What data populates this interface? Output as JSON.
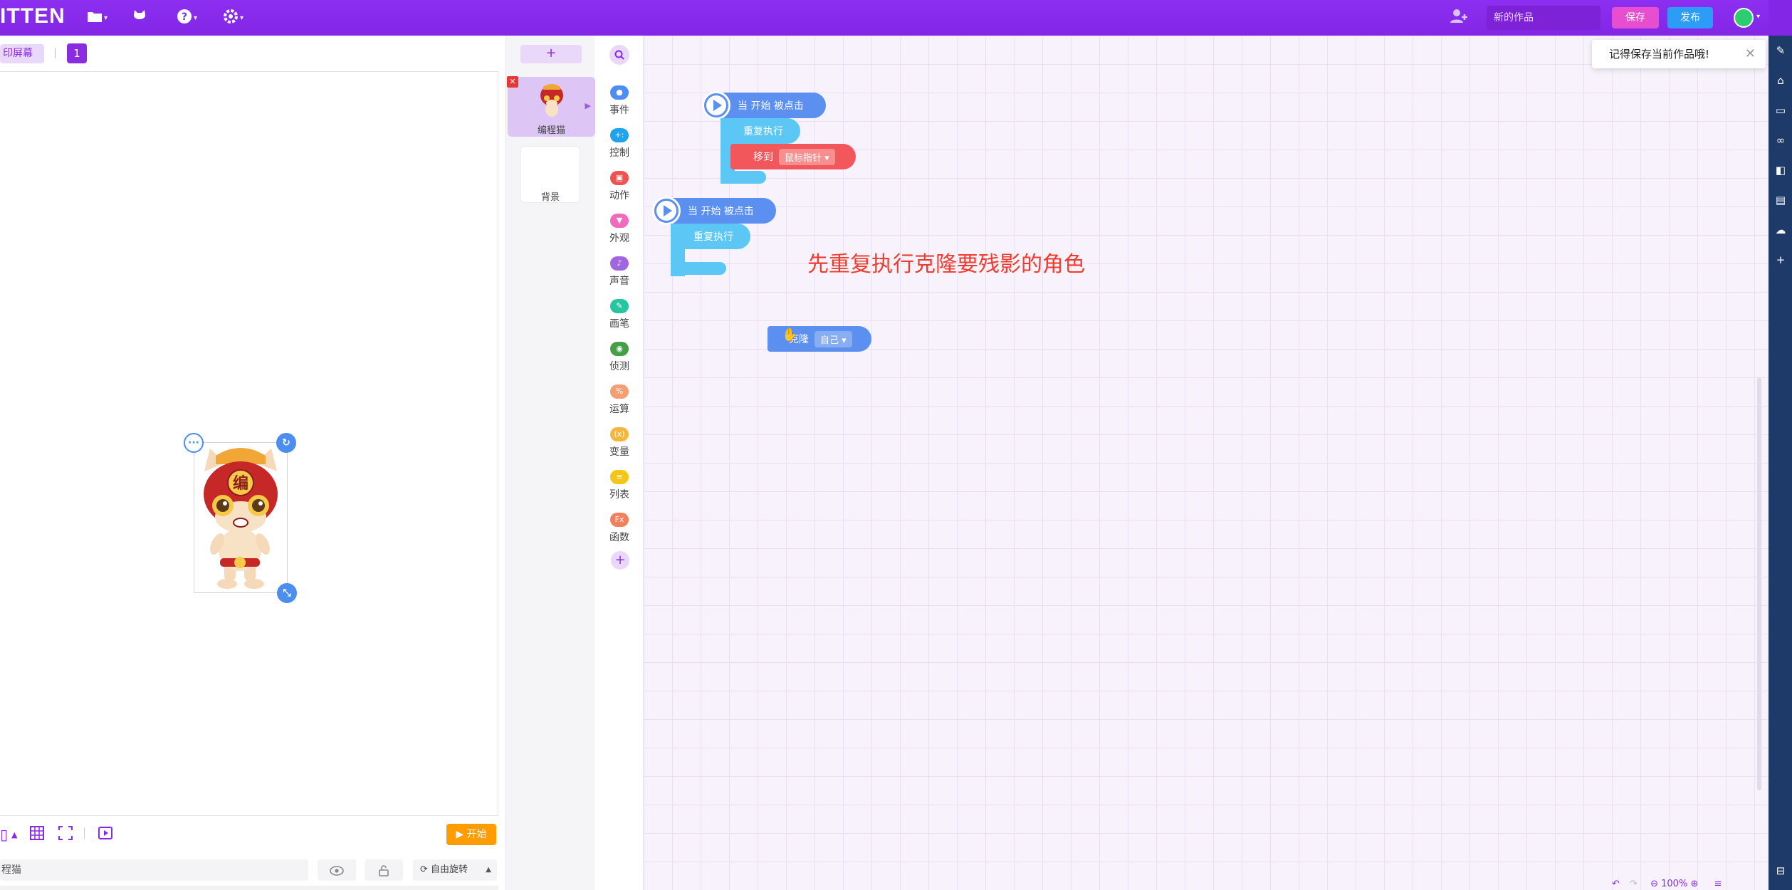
{
  "topbar": {
    "logo": "ITTEN",
    "work_name_placeholder": "新的作品",
    "save_label": "保存",
    "publish_label": "发布",
    "icons": [
      "folder-icon",
      "cat-icon",
      "help-icon",
      "settings-icon",
      "add-user-icon"
    ]
  },
  "stage_header": {
    "fullscreen_label": "印屏幕",
    "screen_number": "1"
  },
  "stage_toolbar": {
    "start_label": "开始",
    "sprite_name": "程猫",
    "rotate_label": "自由旋转"
  },
  "sprite_panel": {
    "add_label": "+",
    "sprites": [
      {
        "label": "编程猫"
      }
    ],
    "background_label": "背景"
  },
  "categories": [
    {
      "label": "事件",
      "color": "#4c8df6",
      "icon": "●"
    },
    {
      "label": "控制",
      "color": "#1fa3ec",
      "icon": "+:"
    },
    {
      "label": "动作",
      "color": "#ef5350",
      "icon": "▣"
    },
    {
      "label": "外观",
      "color": "#f06bbd",
      "icon": "▼"
    },
    {
      "label": "声音",
      "color": "#a066e0",
      "icon": "♪"
    },
    {
      "label": "画笔",
      "color": "#26c6a0",
      "icon": "✎"
    },
    {
      "label": "侦测",
      "color": "#43a047",
      "icon": "◉"
    },
    {
      "label": "运算",
      "color": "#f39f74",
      "icon": "%"
    },
    {
      "label": "变量",
      "color": "#f5b63c",
      "icon": "(x)"
    },
    {
      "label": "列表",
      "color": "#f5c518",
      "icon": "≡"
    },
    {
      "label": "函数",
      "color": "#f0805e",
      "icon": "Fx"
    }
  ],
  "blocks": {
    "script1_hat": "当 开始 被点击",
    "script1_repeat": "重复执行",
    "script1_motion": "移到",
    "script1_motion_target": "鼠标指针",
    "script2_hat": "当 开始 被点击",
    "script2_repeat": "重复执行",
    "clone_label": "克隆",
    "clone_target": "自己"
  },
  "comment": "先重复执行克隆要残影的角色",
  "toast": {
    "message": "记得保存当前作品哦!",
    "close": "✕"
  },
  "zoom": {
    "value": "100%"
  },
  "colors": {
    "brand": "#8a2be2",
    "save": "#e64ecf",
    "publish": "#2c9cf6",
    "start": "#ff9c00"
  }
}
